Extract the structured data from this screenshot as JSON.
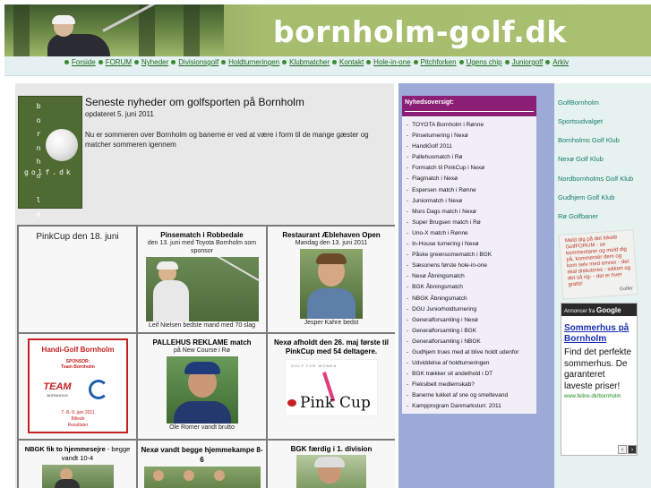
{
  "header": {
    "site_title": "bornholm-golf.dk"
  },
  "nav": {
    "items": [
      "Forside",
      "FORUM",
      "Nyheder",
      "Divisionsgolf",
      "Holdturneringen",
      "Klubmatcher",
      "Kontakt",
      "Hole-in-one",
      "Pitchforken",
      "Ugens chip",
      "Juniorgolf",
      "Arkiv"
    ]
  },
  "logo": {
    "letters": [
      "b",
      "o",
      "r",
      "n",
      "h",
      "o",
      "l",
      "m"
    ],
    "dotcom": "golf.dk"
  },
  "intro": {
    "title": "Seneste nyheder om golfsporten på Bornholm",
    "updated": "opdateret 5. juni 2011",
    "text": "Nu er sommeren over Bornholm og banerne er ved at være i form til de mange gæster og matcher sommeren igennem"
  },
  "grid": {
    "pinkcup_date": "PinkCup den 18. juni",
    "pinsematch": {
      "title": "Pinsematch i Robbedale",
      "sub": "den 13. juni med Toyota Bornholm som sponsor",
      "caption": "Leif Nielsen bedste mand med 70 slag"
    },
    "restaurant": {
      "title": "Restaurant Æblehaven Open",
      "sub": "Mandag den 13. juni 2011",
      "caption": "Jesper Kahre bedst"
    },
    "handigolf": {
      "title": "Handi-Golf Bornholm",
      "sponsor_label": "SPONSOR:",
      "sponsor_name": "Team Bornholm",
      "team_logo": "TEAM",
      "team_sub": "BORNHOLM",
      "dates": "7.-8.-9. juni 2011",
      "billede": "Billede",
      "resultater": "Resultater"
    },
    "pallehus": {
      "title": "PALLEHUS REKLAME match",
      "sub": "på New Course i Rø",
      "caption": "Ole Romer vandt brutto"
    },
    "nexo_pinkcup": {
      "title": "Nexø afholdt den 26. maj første til PinkCup med 54 deltagere.",
      "arc": "GOLF FOR WOMEN",
      "logo_text": "Pink",
      "logo_cup": "Cup"
    },
    "nbgk": {
      "title": "NBGK fik to hjemmesejre",
      "sub": "- begge vandt 10-4"
    },
    "nexo_vandt": {
      "title": "Nexø vandt begge hjemmekampe 8-6"
    },
    "bgk": {
      "title": "BGK færdig i 1. division"
    }
  },
  "news": {
    "header": "Nyhedsoversigt:",
    "items": [
      "TOYOTA Bornholm i Rønne",
      "Pinseturnering i Nexø",
      "HandiGolf 2011",
      "Pallehusmatch i Rø",
      "Formatch til PinkCup i Nexø",
      "Flagmatch i Nexø",
      "Espersen match i Rønne",
      "Juniormatch i Nexø",
      "Mors Dags match i Nexø",
      "Super Brugsen match i Rø",
      "Uno-X match i Rønne",
      "In-House turnering i Nexø",
      "Påske greensomematch i BGK",
      "Sæsonens første hole-in-one",
      "Nexø Åbningsmatch",
      "BGK Åbningsmatch",
      "NBGK Åbningsmatch",
      "DGU Juniorholdturnering",
      "Generalforsamling i Nexø",
      "Generalforsamling i BGK",
      "Generalforsamling i NBGK",
      "Gudhjem trues med at blive holdt udenfor",
      "Udviddelse af holdturneringen",
      "BGK trækker sit andethold i DT",
      "Fleksibelt medlemskab?",
      "Banerne lukket af sne og smeltevand",
      "Kampprogram Danmarksturr. 2011"
    ]
  },
  "right": {
    "links": [
      "GolfBornholm",
      "Sportsudvalget",
      "Bornholms Golf Klub",
      "Nexø Golf Klub",
      "Nordbornholms Golf Klub",
      "Gudhjem Golf Klub",
      "Rø Golfbaner"
    ],
    "sticky_note": "Meld dig på det lokale GolfFORUM - se kommentarer og meld dig på, kommentér dem og kom selv med emner - det skal diskuteres - sikkert og det så rig- - det er hver gratis!",
    "sticky_sig": "Golfer"
  },
  "ad": {
    "label": "Annoncer fra",
    "provider": "Google",
    "title": "Sommerhus på Bornholm",
    "body": "Find det perfekte sommerhus. De garanteret laveste priser!",
    "url": "www.feline.dk/bornholm",
    "prev": "‹",
    "next": "›"
  },
  "colors": {
    "nav_bullet": "#3a8a2e",
    "news_header": "#8b1e75",
    "news_panel": "#9da9d6",
    "right_link": "#1a7a6a"
  }
}
